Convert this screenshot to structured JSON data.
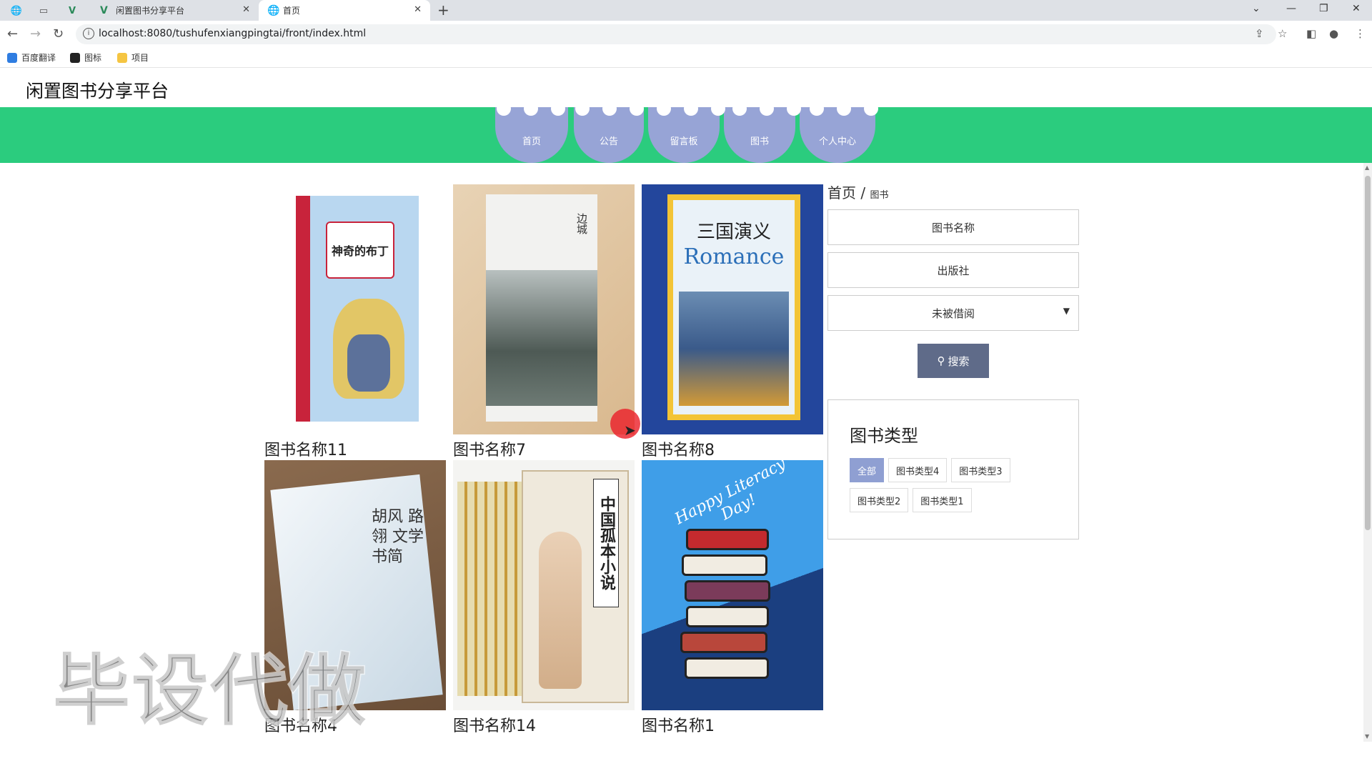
{
  "browser": {
    "tabs": [
      {
        "title": "闲置图书分享平台",
        "active": false
      },
      {
        "title": "首页",
        "active": true
      }
    ],
    "url": "localhost:8080/tushufenxiangpingtai/front/index.html",
    "bookmarks": [
      "百度翻译",
      "图标",
      "项目"
    ]
  },
  "site": {
    "title": "闲置图书分享平台"
  },
  "nav": [
    "首页",
    "公告",
    "留言板",
    "图书",
    "个人中心"
  ],
  "breadcrumb": {
    "home": "首页",
    "sep": "/",
    "current": "图书"
  },
  "search": {
    "name_label": "图书名称",
    "publisher_label": "出版社",
    "status_selected": "未被借阅",
    "button_label": "搜索"
  },
  "categories": {
    "title": "图书类型",
    "items": [
      "全部",
      "图书类型4",
      "图书类型3",
      "图书类型2",
      "图书类型1"
    ],
    "active": "全部"
  },
  "books": [
    {
      "name": "图书名称11",
      "cover_title": "神奇的布丁"
    },
    {
      "name": "图书名称7",
      "cover_title": "边城"
    },
    {
      "name": "图书名称8",
      "cover_title": "三国演义"
    },
    {
      "name": "图书名称4",
      "cover_title": "胡风 路翎 文学书简"
    },
    {
      "name": "图书名称14",
      "cover_title": "中国孤本小说"
    },
    {
      "name": "图书名称1",
      "cover_title": "Happy Literacy Day!"
    }
  ],
  "watermark": "毕设代做",
  "colors": {
    "nav_band": "#2bcc7e",
    "nav_item": "#97a4d6",
    "search_button": "#5f6b89",
    "chip_active": "#8f9fd2"
  }
}
